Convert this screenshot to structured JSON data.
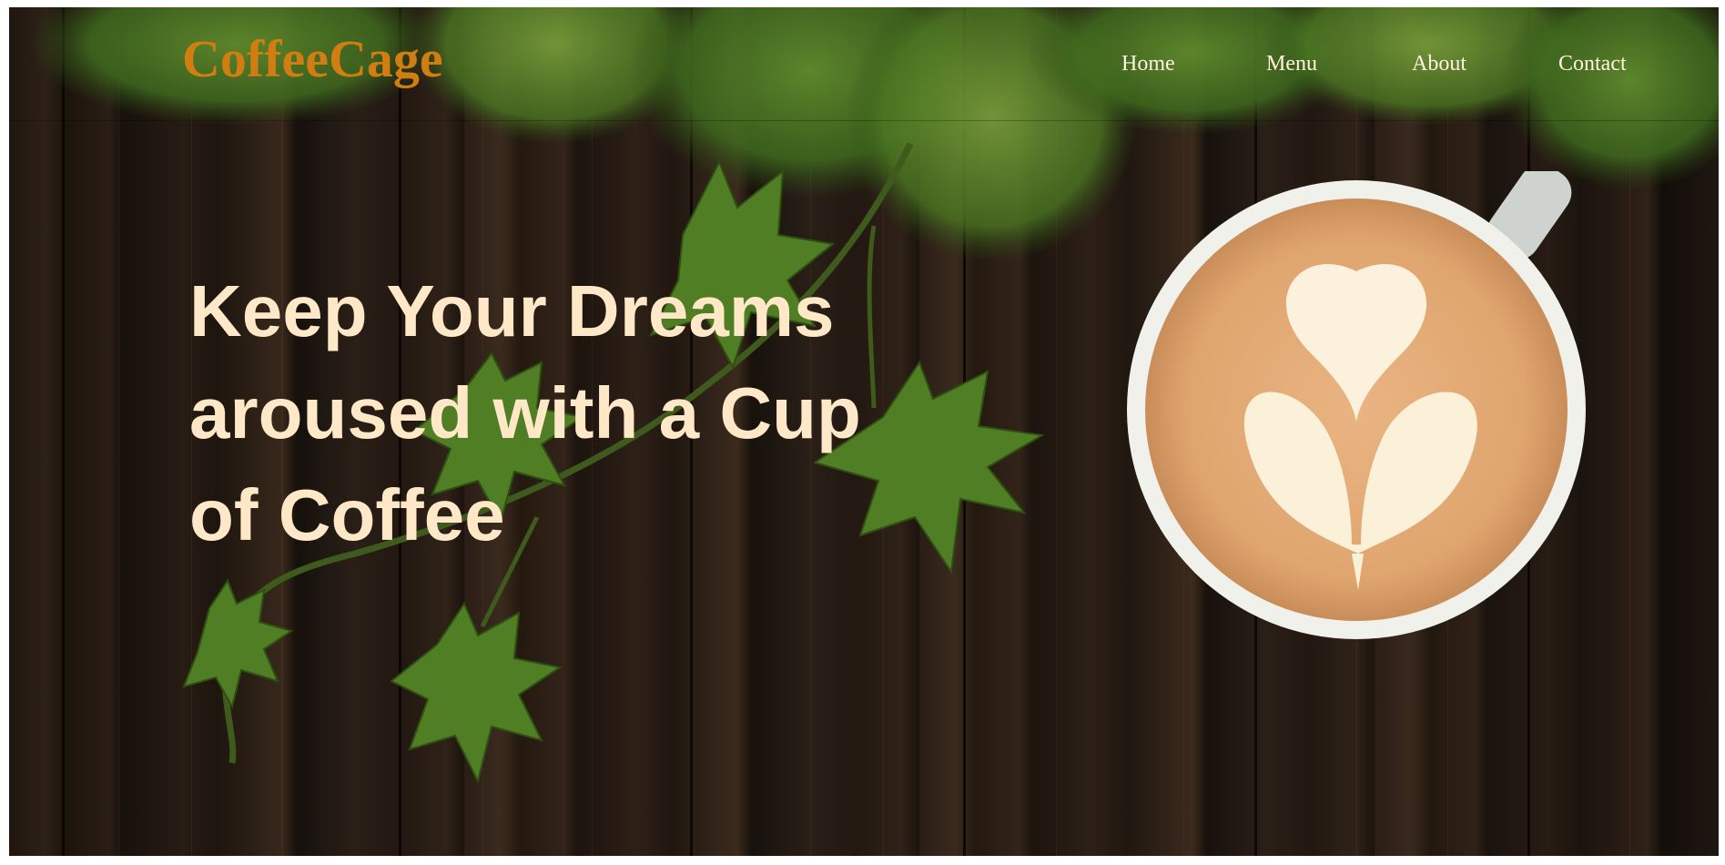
{
  "brand": {
    "name": "CoffeeCage",
    "color": "#d07d12"
  },
  "nav": {
    "items": [
      {
        "label": "Home"
      },
      {
        "label": "Menu"
      },
      {
        "label": "About"
      },
      {
        "label": "Contact"
      }
    ],
    "text_color": "#fff3df"
  },
  "hero": {
    "title_lines": [
      "Keep Your Dreams",
      "aroused with a Cup",
      "of Coffee"
    ],
    "title_color": "#ffe8c8"
  },
  "background": {
    "description_icons": [
      "wood-plank-background",
      "hop-leaves",
      "latte-cup"
    ]
  }
}
